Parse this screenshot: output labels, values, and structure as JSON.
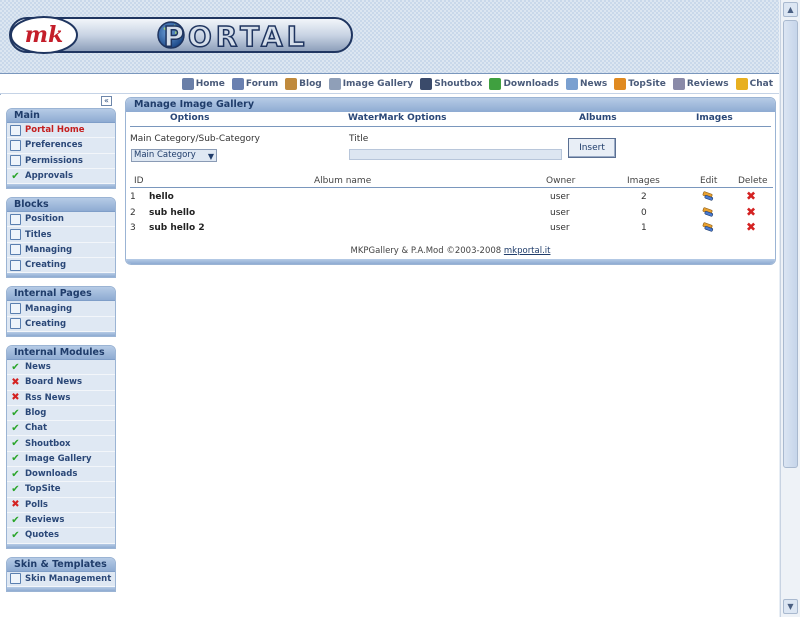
{
  "header": {
    "logo": {
      "prefix": "mk",
      "word": "PORTAL"
    },
    "nav": [
      {
        "label": "Home",
        "icon": "home-icon",
        "color": "#6a7fa8"
      },
      {
        "label": "Forum",
        "icon": "forum-icon",
        "color": "#6a80b0"
      },
      {
        "label": "Blog",
        "icon": "blog-icon",
        "color": "#c08a3c"
      },
      {
        "label": "Image Gallery",
        "icon": "image-gallery-icon",
        "color": "#8f9fb8"
      },
      {
        "label": "Shoutbox",
        "icon": "shoutbox-icon",
        "color": "#3a4a6a"
      },
      {
        "label": "Downloads",
        "icon": "downloads-icon",
        "color": "#3fa03f"
      },
      {
        "label": "News",
        "icon": "news-icon",
        "color": "#7aa0d0"
      },
      {
        "label": "TopSite",
        "icon": "topsite-icon",
        "color": "#e08a20"
      },
      {
        "label": "Reviews",
        "icon": "reviews-icon",
        "color": "#8a8aa8"
      },
      {
        "label": "Chat",
        "icon": "chat-icon",
        "color": "#e8b020"
      }
    ]
  },
  "sidebar": {
    "collapse_label": "«",
    "blocks": [
      {
        "title": "Main",
        "items": [
          {
            "label": "Portal Home",
            "icon": "portal-home-icon",
            "type": "box",
            "active": true
          },
          {
            "label": "Preferences",
            "icon": "preferences-icon",
            "type": "box"
          },
          {
            "label": "Permissions",
            "icon": "permissions-icon",
            "type": "box"
          },
          {
            "label": "Approvals",
            "icon": "approvals-icon",
            "type": "check"
          }
        ]
      },
      {
        "title": "Blocks",
        "items": [
          {
            "label": "Position",
            "icon": "position-icon",
            "type": "box"
          },
          {
            "label": "Titles",
            "icon": "titles-icon",
            "type": "box"
          },
          {
            "label": "Managing",
            "icon": "managing-icon",
            "type": "box"
          },
          {
            "label": "Creating",
            "icon": "creating-icon",
            "type": "box"
          }
        ]
      },
      {
        "title": "Internal Pages",
        "items": [
          {
            "label": "Managing",
            "icon": "managing-icon",
            "type": "box"
          },
          {
            "label": "Creating",
            "icon": "creating-icon",
            "type": "box"
          }
        ]
      },
      {
        "title": "Internal Modules",
        "items": [
          {
            "label": "News",
            "icon": "check-icon",
            "type": "check"
          },
          {
            "label": "Board News",
            "icon": "cross-icon",
            "type": "cross"
          },
          {
            "label": "Rss News",
            "icon": "cross-icon",
            "type": "cross"
          },
          {
            "label": "Blog",
            "icon": "check-icon",
            "type": "check"
          },
          {
            "label": "Chat",
            "icon": "check-icon",
            "type": "check"
          },
          {
            "label": "Shoutbox",
            "icon": "check-icon",
            "type": "check"
          },
          {
            "label": "Image Gallery",
            "icon": "check-icon",
            "type": "check"
          },
          {
            "label": "Downloads",
            "icon": "check-icon",
            "type": "check"
          },
          {
            "label": "TopSite",
            "icon": "check-icon",
            "type": "check"
          },
          {
            "label": "Polls",
            "icon": "cross-icon",
            "type": "cross"
          },
          {
            "label": "Reviews",
            "icon": "check-icon",
            "type": "check"
          },
          {
            "label": "Quotes",
            "icon": "check-icon",
            "type": "check"
          }
        ]
      },
      {
        "title": "Skin & Templates",
        "items": [
          {
            "label": "Skin Management",
            "icon": "skin-management-icon",
            "type": "box"
          }
        ]
      }
    ]
  },
  "main": {
    "title": "Manage Image Gallery",
    "tabs": [
      "Options",
      "WaterMark Options",
      "Albums",
      "Images"
    ],
    "form": {
      "category_label": "Main Category/Sub-Category",
      "category_value": "Main Category",
      "title_label": "Title",
      "title_value": "",
      "insert_label": "Insert"
    },
    "table": {
      "headers": [
        "ID",
        "Album name",
        "Owner",
        "Images",
        "Edit",
        "Delete"
      ],
      "rows": [
        {
          "id": "1",
          "name": "hello",
          "owner": "user",
          "images": "2"
        },
        {
          "id": "2",
          "name": "sub hello",
          "owner": "user",
          "images": "0"
        },
        {
          "id": "3",
          "name": "sub hello 2",
          "owner": "user",
          "images": "1"
        }
      ]
    },
    "footer": {
      "text": "MKPGallery & P.A.Mod ©2003-2008 ",
      "link": "mkportal.it"
    }
  }
}
